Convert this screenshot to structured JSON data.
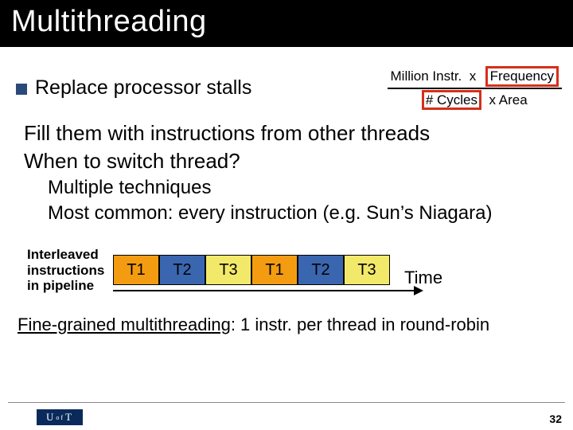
{
  "title": "Multithreading",
  "bullet1": "Replace processor stalls",
  "fraction": {
    "num_left": "Million Instr.",
    "num_x": "x",
    "num_right": "Frequency",
    "den_left": "# Cycles",
    "den_x": "x Area"
  },
  "lvl2a": "Fill them with instructions from other threads",
  "lvl2b": "When to switch thread?",
  "lvl3a": "Multiple techniques",
  "lvl3b": "Most common: every instruction (e.g. Sun’s Niagara)",
  "pipeline": {
    "label_l1": "Interleaved",
    "label_l2": "instructions",
    "label_l3": "in pipeline",
    "boxes": [
      "T1",
      "T2",
      "T3",
      "T1",
      "T2",
      "T3"
    ],
    "time": "Time"
  },
  "fine_underlined": "Fine-grained multithreading",
  "fine_rest": ": 1 instr. per thread in round-robin",
  "logo": {
    "u": "U",
    "of": "of",
    "t": "T"
  },
  "pagenum": "32"
}
